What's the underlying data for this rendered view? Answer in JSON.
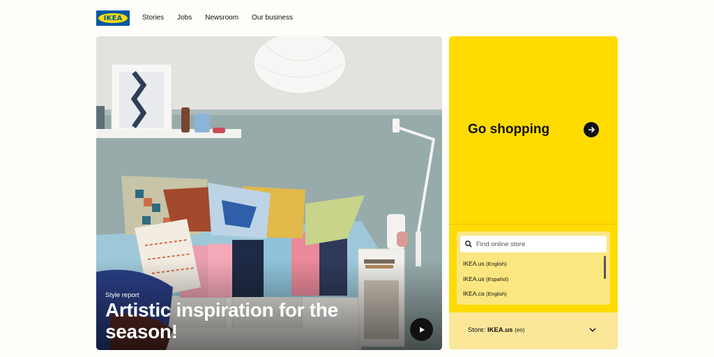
{
  "brand": {
    "logo_text": "IKEA",
    "blue": "#0058a3",
    "yellow": "#ffdb00"
  },
  "nav": {
    "items": [
      "Stories",
      "Jobs",
      "Newsroom",
      "Our business"
    ]
  },
  "hero": {
    "kicker": "Style report",
    "headline": "Artistic inspiration for the season!",
    "play_icon": "play-icon"
  },
  "shop": {
    "title": "Go shopping",
    "arrow_icon": "arrow-right-icon",
    "search": {
      "placeholder": "Find online store",
      "value": ""
    },
    "stores": [
      {
        "name": "IKEA.us",
        "lang": "(English)"
      },
      {
        "name": "IKEA.us",
        "lang": "(Español)"
      },
      {
        "name": "IKEA.ca",
        "lang": "(English)"
      }
    ],
    "current_store": {
      "label": "Store:",
      "name": "IKEA.us",
      "lang": "(en)"
    }
  }
}
